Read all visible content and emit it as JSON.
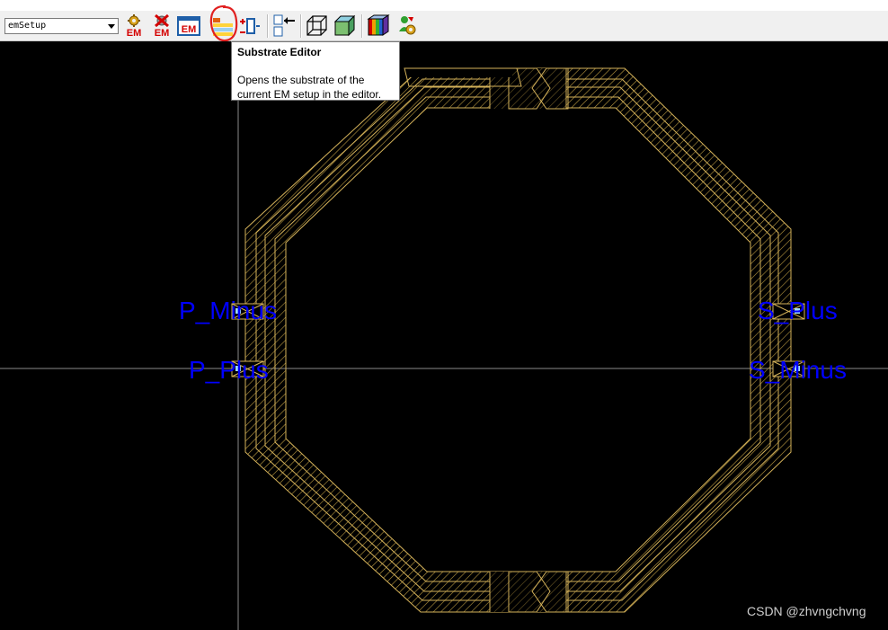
{
  "toolbar": {
    "em_setup_select": {
      "value": "emSetup"
    },
    "buttons": [
      {
        "name": "em-simulate-button",
        "icon": "em-gear-icon",
        "label": "EM"
      },
      {
        "name": "em-stop-button",
        "icon": "em-cross-icon",
        "label": "EM"
      },
      {
        "name": "em-setup-button",
        "icon": "em-box-icon",
        "label": "EM"
      },
      {
        "name": "substrate-editor-button",
        "icon": "substrate-layers-icon"
      },
      {
        "name": "port-editor-button",
        "icon": "port-icon"
      },
      {
        "name": "import-button",
        "icon": "import-arrow-icon"
      },
      {
        "name": "3d-wireframe-button",
        "icon": "wireframe-cube-icon"
      },
      {
        "name": "3d-solid-button",
        "icon": "solid-cube-icon"
      },
      {
        "name": "3d-view-button",
        "icon": "rainbow-cube-icon"
      },
      {
        "name": "optimize-button",
        "icon": "gear-person-icon"
      }
    ]
  },
  "tooltip": {
    "title": "Substrate Editor",
    "body": "Opens the substrate of the current EM setup in the editor."
  },
  "ports": [
    {
      "label": "P_Minus"
    },
    {
      "label": "P_Plus"
    },
    {
      "label": "S_Plus"
    },
    {
      "label": "S_Minus"
    }
  ],
  "watermark": "CSDN @zhvngchvng",
  "colors": {
    "canvas": "#000000",
    "trace": "#d4b25a",
    "port_label": "#0000ff",
    "annotation_circle": "#e02020"
  }
}
